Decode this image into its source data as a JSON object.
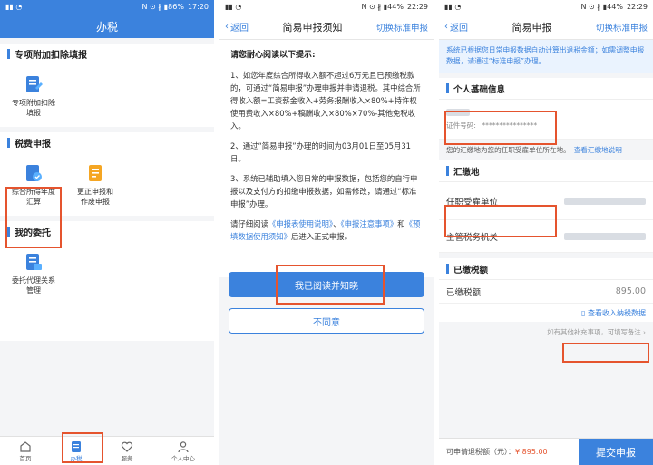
{
  "status": {
    "p1": {
      "icons": "N ⊙ ∦ ▮86%",
      "time": "17:20"
    },
    "p2": {
      "icons": "N ⊙ ∦ ▮44%",
      "time": "22:29"
    },
    "p3": {
      "icons": "N ⊙ ∦ ▮44%",
      "time": "22:29"
    }
  },
  "panel1": {
    "title": "办税",
    "sections": [
      {
        "title": "专项附加扣除填报",
        "tiles": [
          {
            "line1": "专项附加扣除",
            "line2": "填报"
          }
        ]
      },
      {
        "title": "税费申报",
        "tiles": [
          {
            "line1": "综合所得年度",
            "line2": "汇算"
          },
          {
            "line1": "更正申报和",
            "line2": "作废申报"
          }
        ]
      },
      {
        "title": "我的委托",
        "tiles": [
          {
            "line1": "委托代理关系",
            "line2": "管理"
          }
        ]
      }
    ],
    "tabs": [
      "首页",
      "办税",
      "服务",
      "个人中心"
    ]
  },
  "panel2": {
    "back": "返回",
    "title": "简易申报须知",
    "switch": "切换标准申报",
    "heading": "请您耐心阅读以下提示:",
    "p1": "1、如您年度综合所得收入额不超过6万元且已预缴税款的，可通过“简易申报”办理申报并申请退税。其中综合所得收入额=工资薪金收入+劳务报酬收入×80%+特许权使用费收入×80%+稿酬收入×80%×70%-其他免税收入。",
    "p2": "2、通过“简易申报”办理的时间为03月01日至05月31日。",
    "p3": "3、系统已辅助填入您日常的申报数据，包括您的自行申报以及支付方的扣缴申报数据，如需修改，请通过“标准申报”办理。",
    "p4_a": "请仔细阅读",
    "p4_l1": "《申报表使用说明》",
    "p4_b": "、",
    "p4_l2": "《申报注意事项》",
    "p4_c": "和",
    "p4_l3": "《预填数据使用须知》",
    "p4_d": "后进入正式申报。",
    "agree": "我已阅读并知晓",
    "disagree": "不同意"
  },
  "panel3": {
    "back": "返回",
    "title": "简易申报",
    "switch": "切换标准申报",
    "notice": "系统已根据您日常申报数据自动计算出退税金额；如需调整申报数据，请通过“标准申报”办理。",
    "basic_title": "个人基础信息",
    "id_label": "证件号码:",
    "id_value": "****************",
    "tip": "您的汇缴地为您的任职受雇单位所在地。",
    "tip_link": "查看汇缴地说明",
    "place_title": "汇缴地",
    "employer_label": "任职受雇单位",
    "authority_label": "主管税务机关",
    "paid_title": "已缴税额",
    "paid_label": "已缴税额",
    "paid_value": "895.00",
    "view_link": "查看收入纳税数据",
    "more_tip": "如有其他补充事项，可填写备注 ›",
    "refund_label": "可申请退税额（元）：",
    "refund_value": "¥ 895.00",
    "submit": "提交申报"
  },
  "colors": {
    "accent": "#3b82dd",
    "highlight": "#e5542e"
  }
}
